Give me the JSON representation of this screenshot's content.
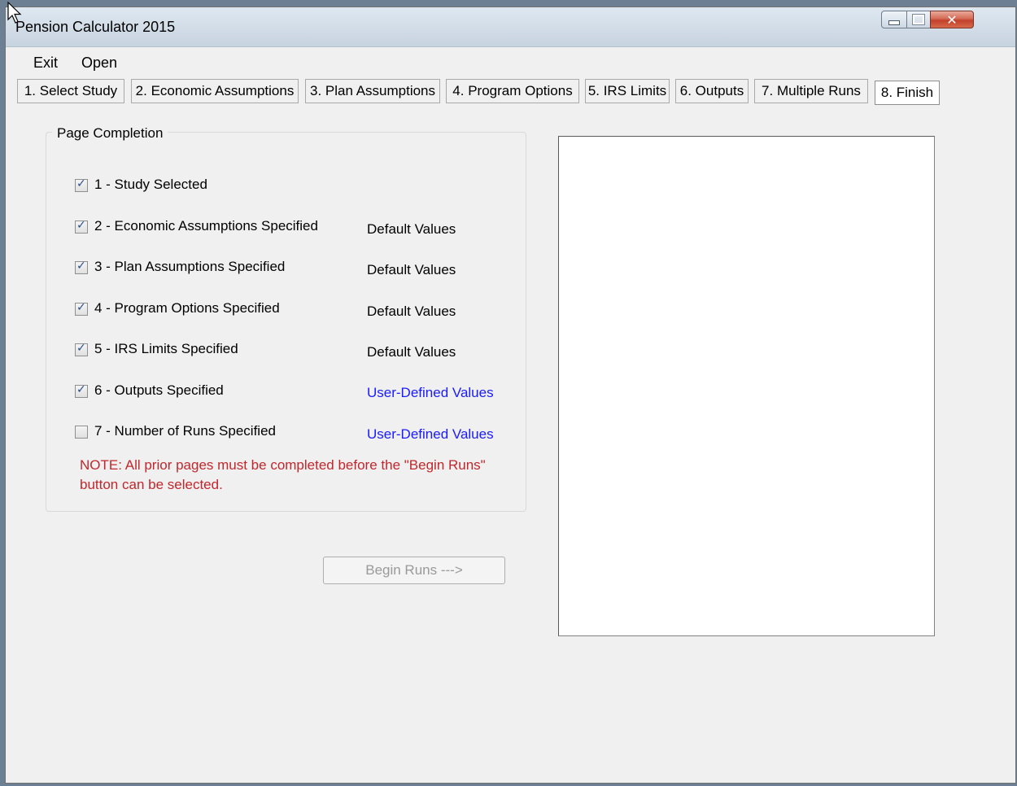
{
  "window": {
    "title": "Pension Calculator 2015",
    "controls": {
      "minimize": "minimize-icon",
      "maximize": "maximize-icon",
      "close": "close-icon"
    }
  },
  "menu": {
    "exit": "Exit",
    "open": "Open"
  },
  "tabs": [
    {
      "label": "1. Select Study"
    },
    {
      "label": "2. Economic Assumptions"
    },
    {
      "label": "3. Plan Assumptions"
    },
    {
      "label": "4. Program Options"
    },
    {
      "label": "5. IRS Limits"
    },
    {
      "label": "6. Outputs"
    },
    {
      "label": "7. Multiple Runs"
    },
    {
      "label": "8. Finish",
      "active": true
    }
  ],
  "page_completion": {
    "title": "Page Completion",
    "items": [
      {
        "label": "1 - Study Selected",
        "checked": true,
        "status": ""
      },
      {
        "label": "2 - Economic Assumptions Specified",
        "checked": true,
        "status": "Default Values"
      },
      {
        "label": "3 - Plan Assumptions Specified",
        "checked": true,
        "status": "Default Values"
      },
      {
        "label": "4 - Program Options Specified",
        "checked": true,
        "status": "Default Values"
      },
      {
        "label": "5 - IRS Limits Specified",
        "checked": true,
        "status": "Default Values"
      },
      {
        "label": "6 - Outputs Specified",
        "checked": true,
        "status": "User-Defined Values"
      },
      {
        "label": "7 - Number of Runs Specified",
        "checked": false,
        "status": "User-Defined Values"
      }
    ],
    "note": "NOTE: All prior pages must be completed before the \"Begin Runs\" button can be selected."
  },
  "begin_button": {
    "label": "Begin Runs --->",
    "enabled": false
  },
  "colors": {
    "note": "#c0272d",
    "user_defined": "#1a1aff",
    "checkmark": "#2b4f86"
  }
}
